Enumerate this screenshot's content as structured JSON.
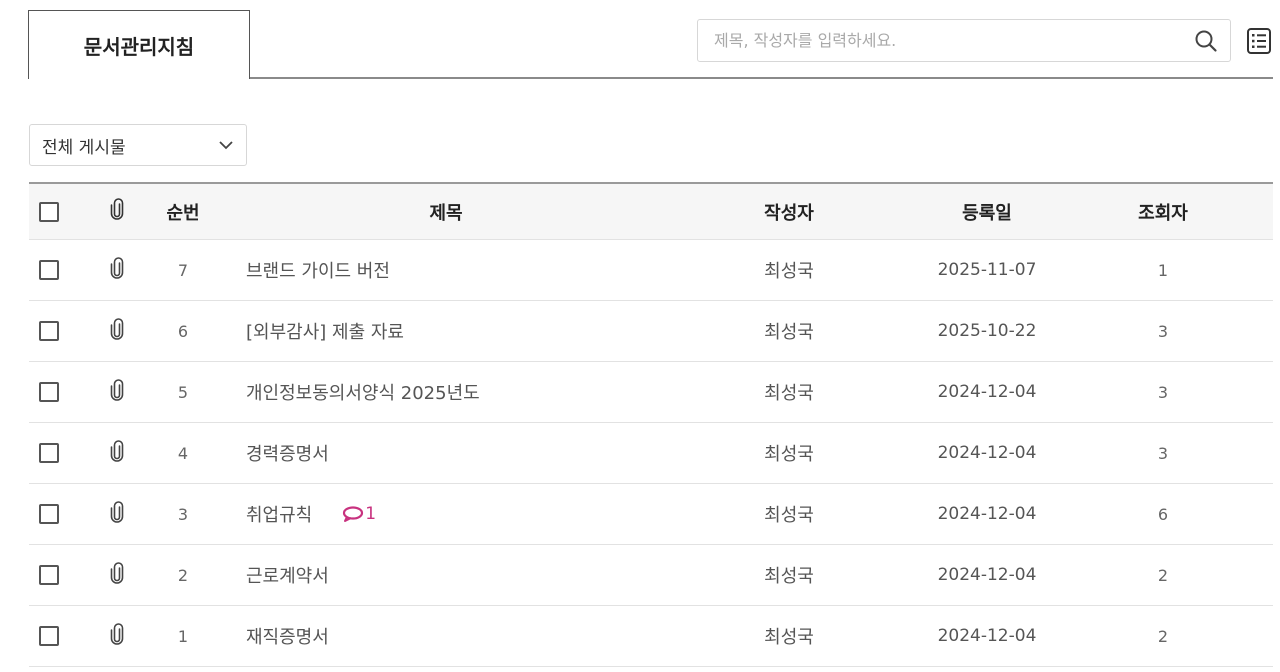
{
  "board": {
    "tab_label": "문서관리지침",
    "search_placeholder": "제목, 작성자를 입력하세요.",
    "filter_label": "전체 게시물"
  },
  "table": {
    "headers": {
      "number": "순번",
      "title": "제목",
      "author": "작성자",
      "date": "등록일",
      "views": "조회자"
    },
    "rows": [
      {
        "number": "7",
        "title": "브랜드 가이드 버전",
        "author": "최성국",
        "date": "2025-11-07",
        "views": "1"
      },
      {
        "number": "6",
        "title": "[외부감사] 제출 자료",
        "author": "최성국",
        "date": "2025-10-22",
        "views": "3"
      },
      {
        "number": "5",
        "title": "개인정보동의서양식 2025년도",
        "author": "최성국",
        "date": "2024-12-04",
        "views": "3"
      },
      {
        "number": "4",
        "title": "경력증명서",
        "author": "최성국",
        "date": "2024-12-04",
        "views": "3"
      },
      {
        "number": "3",
        "title": "취업규칙",
        "comment_count": "1",
        "author": "최성국",
        "date": "2024-12-04",
        "views": "6"
      },
      {
        "number": "2",
        "title": "근로계약서",
        "author": "최성국",
        "date": "2024-12-04",
        "views": "2"
      },
      {
        "number": "1",
        "title": "재직증명서",
        "author": "최성국",
        "date": "2024-12-04",
        "views": "2"
      }
    ]
  },
  "icons": {
    "search": "search-icon",
    "list_view": "list-view-icon",
    "attachment": "paperclip-icon",
    "comment": "comment-icon",
    "dropdown": "chevron-down-icon"
  },
  "colors": {
    "comment_accent": "#c8327f",
    "header_bg": "#f6f6f6"
  }
}
